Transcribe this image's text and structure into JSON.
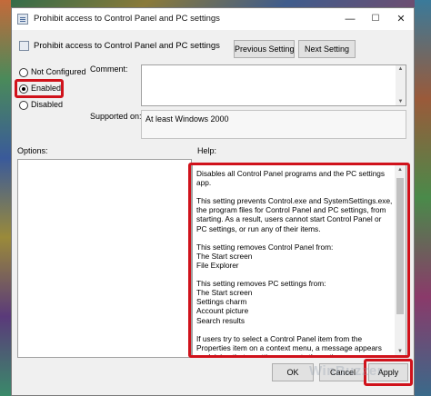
{
  "window": {
    "title": "Prohibit access to Control Panel and PC settings",
    "controls": {
      "minimize": "—",
      "maximize": "☐",
      "close": "✕"
    }
  },
  "header": {
    "policy_name": "Prohibit access to Control Panel and PC settings",
    "previous_label": "Previous Setting",
    "next_label": "Next Setting"
  },
  "state": {
    "options": [
      {
        "label": "Not Configured",
        "selected": false
      },
      {
        "label": "Enabled",
        "selected": true
      },
      {
        "label": "Disabled",
        "selected": false
      }
    ]
  },
  "comment": {
    "label": "Comment:",
    "value": ""
  },
  "supported": {
    "label": "Supported on:",
    "value": "At least Windows 2000"
  },
  "options_label": "Options:",
  "help": {
    "label": "Help:",
    "paragraphs": [
      "Disables all Control Panel programs and the PC settings app.",
      "This setting prevents Control.exe and SystemSettings.exe, the program files for Control Panel and PC settings, from starting. As a result, users cannot start Control Panel or PC settings, or run any of their items.",
      "This setting removes Control Panel from:\nThe Start screen\nFile Explorer",
      "This setting removes PC settings from:\nThe Start screen\nSettings charm\nAccount picture\nSearch results",
      "If users try to select a Control Panel item from the Properties item on a context menu, a message appears explaining that a setting prevents the action."
    ]
  },
  "footer": {
    "ok_label": "OK",
    "cancel_label": "Cancel",
    "apply_label": "Apply"
  },
  "watermark": "WinBuzzer",
  "colors": {
    "highlight": "#d0121b",
    "window_bg": "#f0f0f0"
  }
}
